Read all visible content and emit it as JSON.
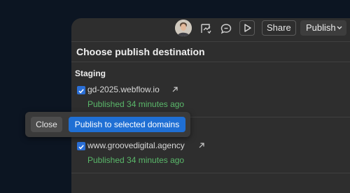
{
  "header": {
    "share_label": "Share",
    "publish_label": "Publish"
  },
  "panel": {
    "title": "Choose publish destination",
    "staging": {
      "section_title": "Staging",
      "domain": "gd-2025.webflow.io",
      "status": "Published 34 minutes ago",
      "checked": true
    },
    "production": {
      "domain": "www.groovedigital.agency",
      "status": "Published 34 minutes ago",
      "checked": true
    }
  },
  "toast": {
    "close_label": "Close",
    "confirm_label": "Publish to selected domains"
  },
  "colors": {
    "accent": "#1f6fd4",
    "status_green": "#5ab86a",
    "panel_bg": "#2e2e2e",
    "page_bg": "#0c1522"
  }
}
